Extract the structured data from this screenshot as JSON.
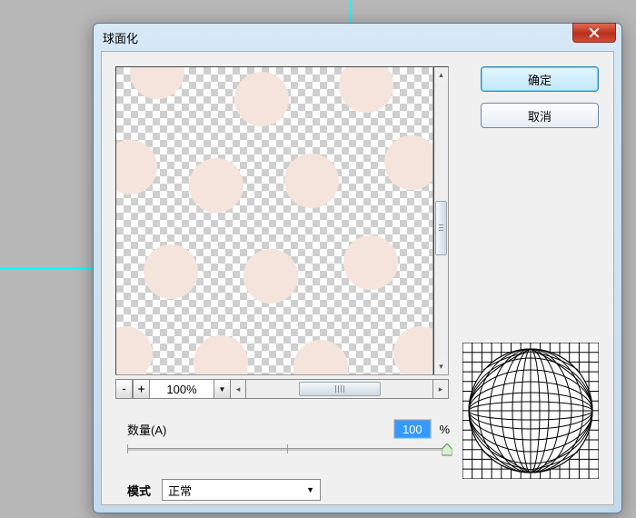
{
  "dialog": {
    "title": "球面化",
    "ok_label": "确定",
    "cancel_label": "取消"
  },
  "zoom": {
    "minus": "-",
    "plus": "+",
    "value": "100%",
    "dropdown": "▼"
  },
  "amount": {
    "label": "数量(A)",
    "value": "100",
    "unit": "%"
  },
  "slider": {
    "min": -100,
    "max": 100,
    "value": 100
  },
  "mode": {
    "label": "模式",
    "selected": "正常"
  },
  "scroll": {
    "up": "▴",
    "down": "▾",
    "left": "◂",
    "right": "▸"
  }
}
